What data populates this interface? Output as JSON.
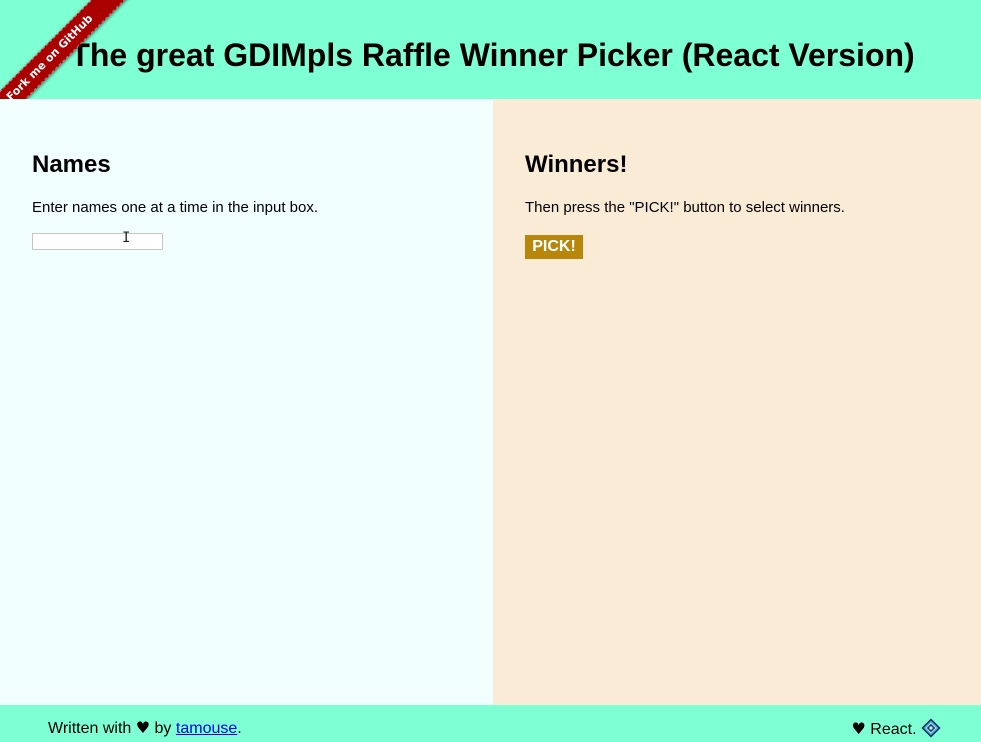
{
  "header": {
    "title": "The great GDIMpls Raffle Winner Picker (React Version)",
    "ribbon_label": "Fork me on GitHub"
  },
  "names_panel": {
    "heading": "Names",
    "instructions": "Enter names one at a time in the input box.",
    "input_value": "",
    "input_placeholder": ""
  },
  "winners_panel": {
    "heading": "Winners!",
    "instructions": "Then press the \"PICK!\" button to select winners.",
    "pick_label": "PICK!"
  },
  "footer": {
    "written_with": "Written with",
    "heart": "♥",
    "by": "by",
    "author_link": "tamouse",
    "period": ".",
    "react_text": "React.",
    "heart_icon": "heart-icon",
    "react_icon": "react-logo-icon"
  },
  "colors": {
    "header_bg": "#7fffd4",
    "names_bg": "#f0fffe",
    "winners_bg": "#faebd7",
    "pick_button": "#b8860b",
    "ribbon": "#aa0000",
    "link": "#0000ee"
  }
}
